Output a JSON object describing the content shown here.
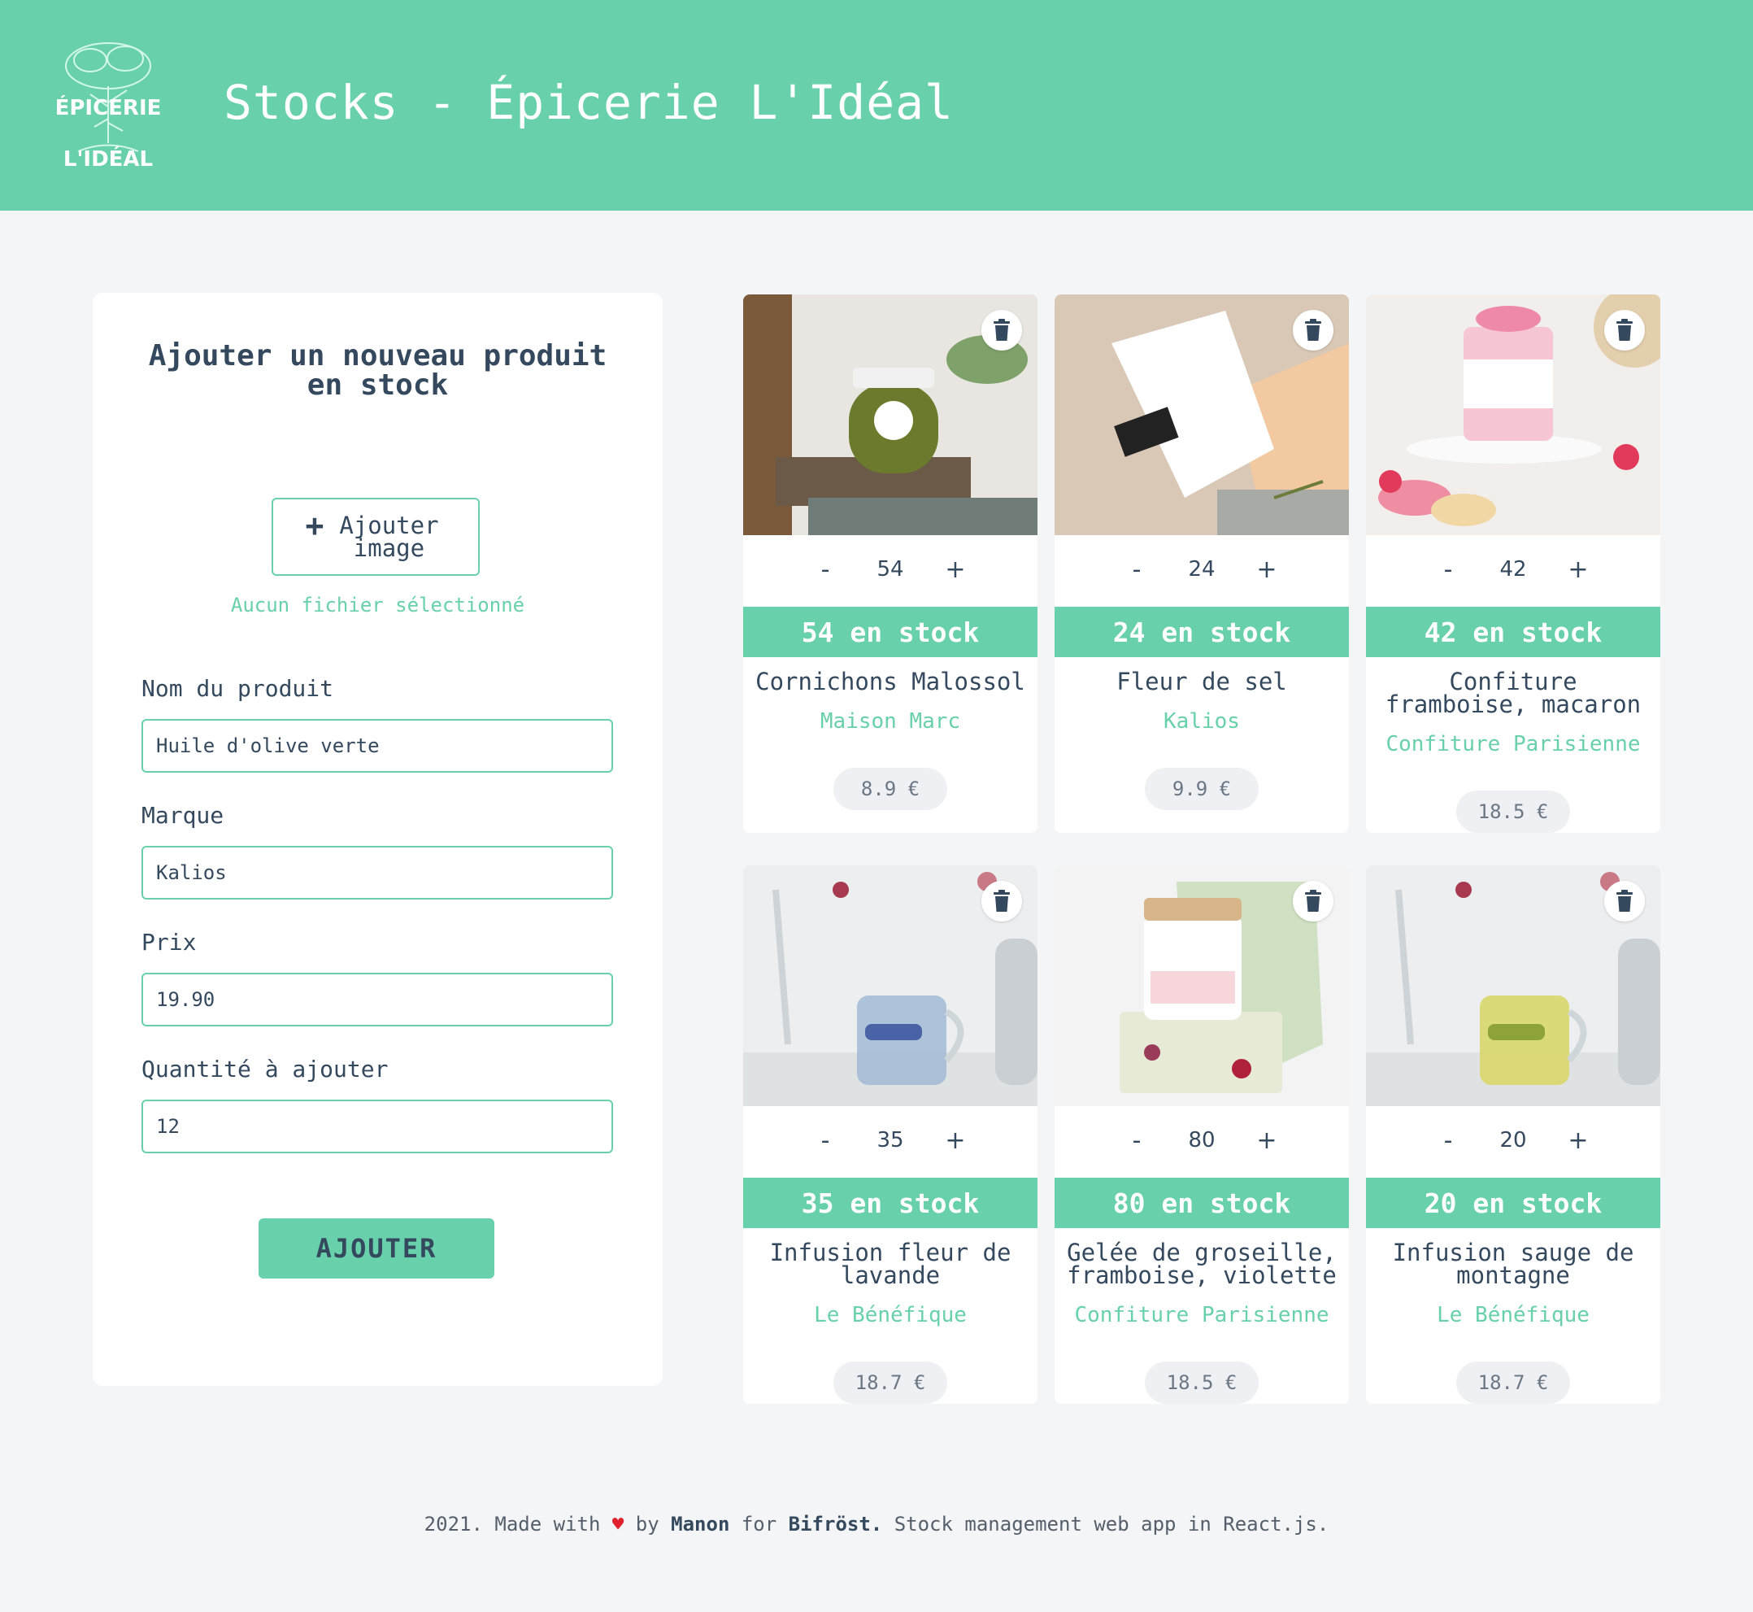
{
  "header": {
    "title": "Stocks - Épicerie L'Idéal",
    "logo_top": "ÉPICERIE",
    "logo_bottom": "L'IDÉAL"
  },
  "form": {
    "title_line1": "Ajouter un nouveau produit",
    "title_line2": "en stock",
    "upload_line1": "Ajouter",
    "upload_line2": "image",
    "no_file": "Aucun fichier sélectionné",
    "name_label": "Nom du produit",
    "name_value": "Huile d'olive verte",
    "brand_label": "Marque",
    "brand_value": "Kalios",
    "price_label": "Prix",
    "price_value": "19.90",
    "qty_label": "Quantité à ajouter",
    "qty_value": "12",
    "submit_label": "AJOUTER"
  },
  "products": [
    {
      "qty": "54",
      "stock": "54 en stock",
      "name": "Cornichons Malossol",
      "brand": "Maison Marc",
      "price": "8.9 €"
    },
    {
      "qty": "24",
      "stock": "24 en stock",
      "name": "Fleur de sel",
      "brand": "Kalios",
      "price": "9.9 €"
    },
    {
      "qty": "42",
      "stock": "42 en stock",
      "name": "Confiture framboise, macaron",
      "brand": "Confiture Parisienne",
      "price": "18.5 €"
    },
    {
      "qty": "35",
      "stock": "35 en stock",
      "name": "Infusion fleur de lavande",
      "brand": "Le Bénéfique",
      "price": "18.7 €"
    },
    {
      "qty": "80",
      "stock": "80 en stock",
      "name": "Gelée de groseille, framboise, violette",
      "brand": "Confiture Parisienne",
      "price": "18.5 €"
    },
    {
      "qty": "20",
      "stock": "20 en stock",
      "name": "Infusion sauge de montagne",
      "brand": "Le Bénéfique",
      "price": "18.7 €"
    }
  ],
  "qty_minus": "-",
  "qty_plus": "+",
  "footer": {
    "part1": "2021. Made with",
    "heart": "♥",
    "part2": "by",
    "author": "Manon",
    "part3": "for",
    "org": "Bifröst.",
    "part4": "Stock management web app in React.js."
  },
  "colors": {
    "accent": "#68d0aa",
    "text": "#35495e",
    "background": "#f4f5f7"
  }
}
